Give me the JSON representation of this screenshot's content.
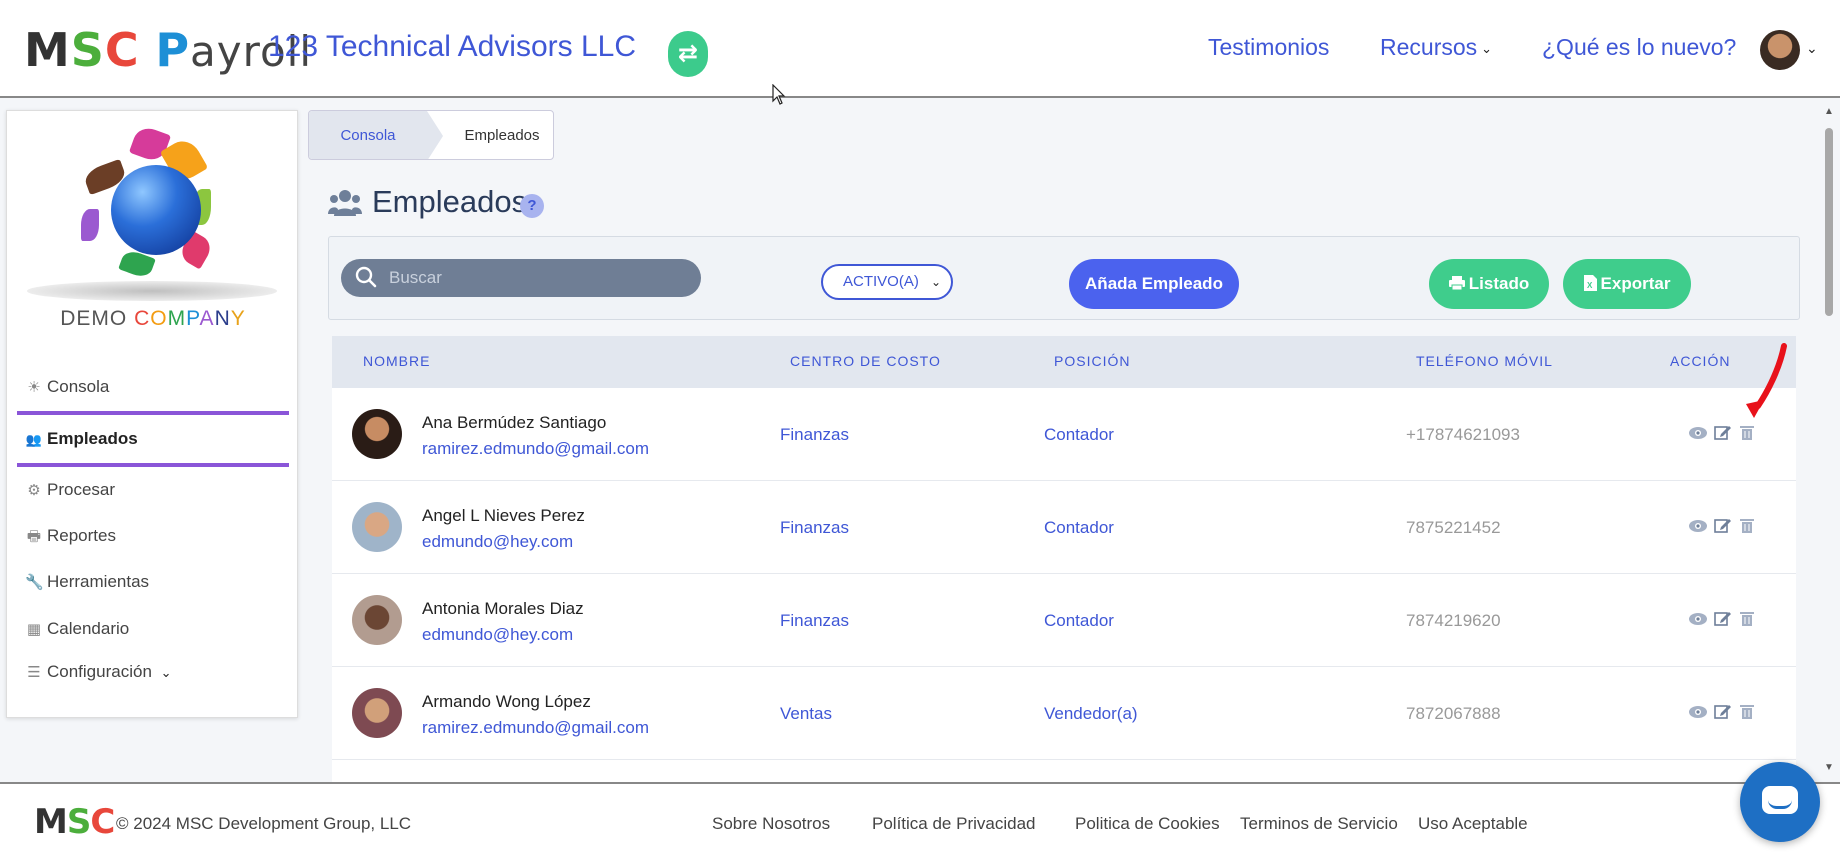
{
  "header": {
    "logo": {
      "m": "M",
      "s": "S",
      "c": "C",
      "p": "P",
      "ayroll": "ayroll"
    },
    "company": "123 Technical Advisors LLC",
    "swap_icon": "⇄",
    "nav": [
      {
        "label": "Testimonios"
      },
      {
        "label": "Recursos",
        "has_caret": true
      },
      {
        "label": "¿Qué es lo nuevo?"
      }
    ],
    "caret": "⌄"
  },
  "sidebar": {
    "brand": {
      "demo": "DEMO ",
      "c": "C",
      "o": "O",
      "m": "M",
      "p": "P",
      "a": "A",
      "n": "N",
      "y": "Y"
    },
    "items": [
      {
        "label": "Consola",
        "icon": "☀"
      },
      {
        "label": "Empleados",
        "icon": "👥",
        "active": true
      },
      {
        "label": "Procesar",
        "icon": "⚙"
      },
      {
        "label": "Reportes",
        "icon": "🖶"
      },
      {
        "label": "Herramientas",
        "icon": "🔧"
      },
      {
        "label": "Calendario",
        "icon": "▦"
      },
      {
        "label": "Configuración",
        "icon": "☰",
        "caret": "⌄"
      }
    ]
  },
  "breadcrumb": {
    "first": "Consola",
    "second": "Empleados"
  },
  "page": {
    "title": "Empleados",
    "help": "?"
  },
  "toolbar": {
    "search_placeholder": "Buscar",
    "status_value": "ACTIVO(A)",
    "status_caret": "⌄",
    "add_label": "Añada Empleado",
    "list_label": "Listado",
    "export_label": "Exportar"
  },
  "table": {
    "headers": [
      "NOMBRE",
      "CENTRO DE COSTO",
      "POSICIÓN",
      "TELÉFONO MÓVIL",
      "ACCIÓN"
    ],
    "rows": [
      {
        "name": "Ana Bermúdez Santiago",
        "email": "ramirez.edmundo@gmail.com",
        "cost_center": "Finanzas",
        "position": "Contador",
        "phone": "+17874621093"
      },
      {
        "name": "Angel L Nieves Perez",
        "email": "edmundo@hey.com",
        "cost_center": "Finanzas",
        "position": "Contador",
        "phone": "7875221452"
      },
      {
        "name": "Antonia Morales Diaz",
        "email": "edmundo@hey.com",
        "cost_center": "Finanzas",
        "position": "Contador",
        "phone": "7874219620"
      },
      {
        "name": "Armando Wong López",
        "email": "ramirez.edmundo@gmail.com",
        "cost_center": "Ventas",
        "position": "Vendedor(a)",
        "phone": "7872067888"
      }
    ]
  },
  "footer": {
    "logo": {
      "m": "M",
      "s": "S",
      "c": "C"
    },
    "copyright": "© 2024 MSC Development Group, LLC",
    "links": [
      "Sobre Nosotros",
      "Política de Privacidad",
      "Politica de Cookies",
      "Terminos de Servicio",
      "Uso Aceptable"
    ]
  },
  "colors": {
    "accent": "#3f57d6",
    "green": "#3fcd8c",
    "blue_button": "#4b62ee",
    "active_bar": "#8a55d8"
  }
}
